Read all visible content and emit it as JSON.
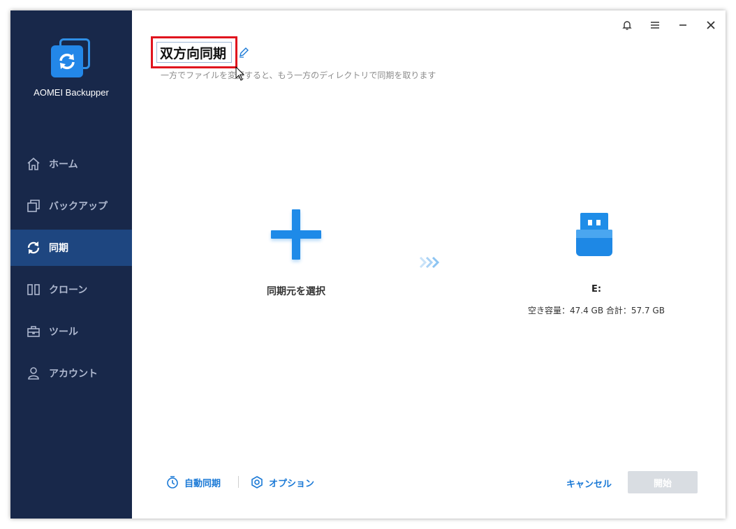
{
  "app": {
    "name": "AOMEI Backupper"
  },
  "sidebar": {
    "items": [
      {
        "label": "ホーム",
        "icon": "home-icon"
      },
      {
        "label": "バックアップ",
        "icon": "backup-icon"
      },
      {
        "label": "同期",
        "icon": "sync-icon",
        "active": true
      },
      {
        "label": "クローン",
        "icon": "clone-icon"
      },
      {
        "label": "ツール",
        "icon": "tools-icon"
      },
      {
        "label": "アカウント",
        "icon": "account-icon"
      }
    ]
  },
  "header": {
    "title_value": "双方向同期",
    "subtitle": "一方でファイルを変更すると、もう一方のディレクトリで同期を取ります"
  },
  "source": {
    "label": "同期元を選択"
  },
  "target": {
    "drive": "E:",
    "info": "空き容量：47.4 GB 合計：57.7 GB"
  },
  "footer": {
    "auto_sync": "自動同期",
    "options": "オプション",
    "cancel": "キャンセル",
    "start": "開始"
  },
  "colors": {
    "sidebar": "#18284a",
    "active": "#1e4680",
    "accent": "#1e8ae8",
    "highlight_border": "#e0141e"
  }
}
